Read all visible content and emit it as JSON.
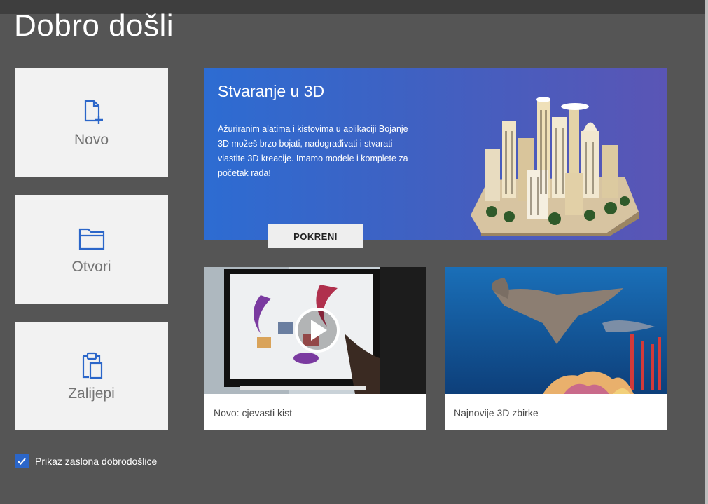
{
  "page": {
    "title": "Dobro došli"
  },
  "actions": [
    {
      "label": "Novo",
      "icon": "new-file-icon"
    },
    {
      "label": "Otvori",
      "icon": "folder-icon"
    },
    {
      "label": "Zalijepi",
      "icon": "paste-icon"
    }
  ],
  "hero": {
    "title": "Stvaranje u 3D",
    "description": "Ažuriranim alatima i kistovima u aplikaciji Bojanje 3D možeš brzo bojati, nadograđivati i stvarati vlastite 3D kreacije. Imamo modele i komplete za početak rada!",
    "button_label": "POKRENI",
    "art_icon": "3d-city-model"
  },
  "cards": [
    {
      "caption": "Novo: cjevasti kist",
      "media": "video-thumbnail",
      "icon": "play-icon"
    },
    {
      "caption": "Najnovije 3D zbirke",
      "media": "underwater-stingray-scene"
    }
  ],
  "welcome_toggle": {
    "label": "Prikaz zaslona dobrodošlice",
    "checked": true
  },
  "colors": {
    "background": "#555555",
    "accent": "#2b66c9",
    "tile": "#f2f2f2",
    "hero_gradient_start": "#2d6cd2",
    "hero_gradient_end": "#5a55b5"
  }
}
